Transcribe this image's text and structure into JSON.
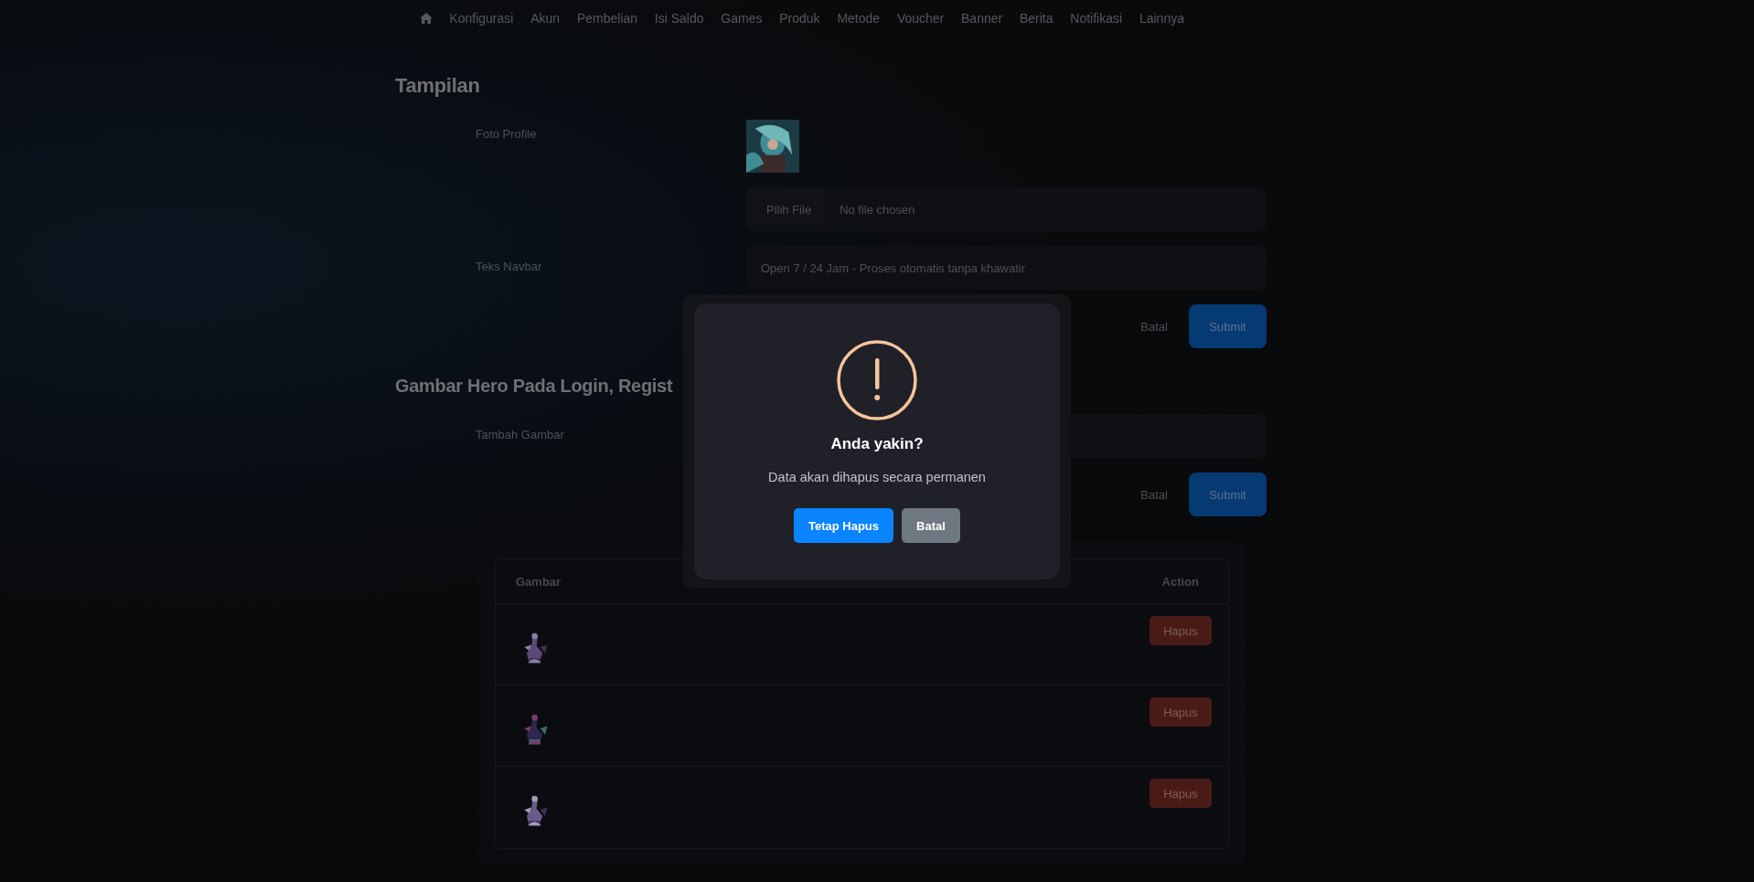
{
  "nav": {
    "items": [
      "Konfigurasi",
      "Akun",
      "Pembelian",
      "Isi Saldo",
      "Games",
      "Produk",
      "Metode",
      "Voucher",
      "Banner",
      "Berita",
      "Notifikasi",
      "Lainnya"
    ]
  },
  "sections": [
    {
      "title": "Tampilan",
      "fields": [
        {
          "kind": "image_file",
          "label": "Foto Profile",
          "button": "Pilih File",
          "value": "No file chosen"
        },
        {
          "kind": "text",
          "label": "Teks Navbar",
          "value": "Open 7 / 24 Jam - Proses otomatis tanpa khawatir"
        }
      ],
      "actions": [
        "Batal",
        "Submit"
      ]
    },
    {
      "title": "Gambar Hero Pada Login, Regist",
      "fields": [
        {
          "kind": "file",
          "label": "Tambah Gambar"
        }
      ],
      "actions": [
        "Batal",
        "Submit"
      ]
    }
  ],
  "table": {
    "columns": [
      "Gambar",
      "Action"
    ],
    "rows": [
      {
        "action": "Hapus"
      },
      {
        "action": "Hapus"
      },
      {
        "action": "Hapus"
      }
    ]
  },
  "dialog": {
    "title": "Anda yakin?",
    "message": "Data akan dihapus secara permanen",
    "confirm": "Tetap Hapus",
    "cancel": "Batal"
  }
}
